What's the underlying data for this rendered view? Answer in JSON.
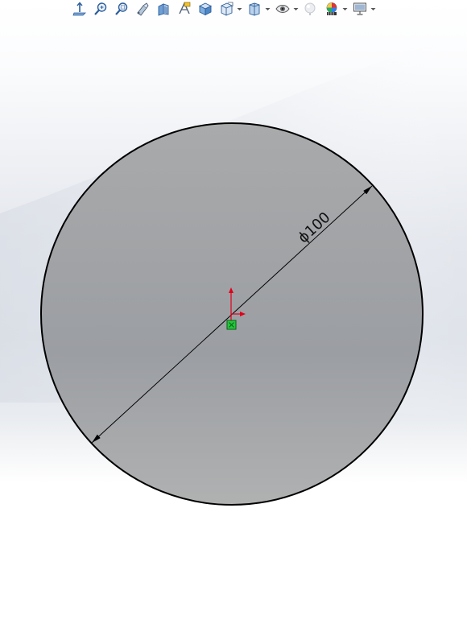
{
  "toolbar": {
    "items": [
      {
        "icon": "view-normal-to-icon"
      },
      {
        "icon": "zoom-to-fit-icon"
      },
      {
        "icon": "zoom-to-area-icon"
      },
      {
        "icon": "previous-view-icon"
      },
      {
        "icon": "section-view-icon"
      },
      {
        "icon": "dynamic-annotation-views-icon"
      },
      {
        "icon": "view-orientation-icon"
      },
      {
        "icon": "display-style-icon",
        "dropdown": true
      },
      {
        "icon": "hide-show-items-icon",
        "dropdown": true
      },
      {
        "icon": "edit-appearance-icon",
        "dropdown": true
      },
      {
        "icon": "apply-scene-icon"
      },
      {
        "icon": "view-settings-icon",
        "dropdown": true
      },
      {
        "icon": "display-monitor-icon",
        "dropdown": true
      }
    ]
  },
  "sketch": {
    "dimension_text": "ϕ100",
    "dimension_value": 100,
    "dimension_type": "diameter",
    "colors": {
      "body_fill_top": "#a9aaab",
      "body_fill_bottom": "#b0b1b1",
      "outline": "#000000",
      "origin_x_axis": "#e0001b",
      "origin_y_axis": "#e0001b",
      "origin_point": "#22c93a"
    }
  }
}
